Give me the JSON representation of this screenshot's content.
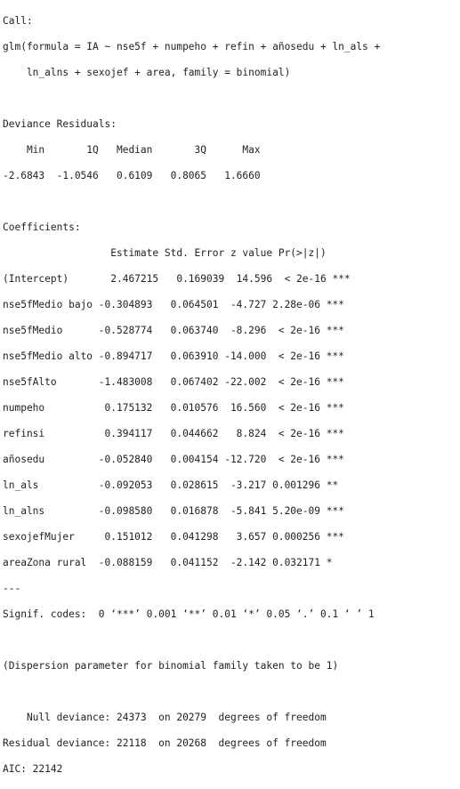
{
  "console": {
    "call_header": "Call:",
    "call_line1": "glm(formula = IA ~ nse5f + numpeho + refin + añosedu + ln_als +",
    "call_line2": "    ln_alns + sexojef + area, family = binomial)",
    "resid_header": "Deviance Residuals:",
    "resid_labels": "    Min       1Q   Median       3Q      Max",
    "resid_values": "-2.6843  -1.0546   0.6109   0.8065   1.6660",
    "coef_header": "Coefficients:",
    "coef_columns": "                  Estimate Std. Error z value Pr(>|z|)",
    "coef_rows": [
      "(Intercept)       2.467215   0.169039  14.596  < 2e-16 ***",
      "nse5fMedio bajo -0.304893   0.064501  -4.727 2.28e-06 ***",
      "nse5fMedio      -0.528774   0.063740  -8.296  < 2e-16 ***",
      "nse5fMedio alto -0.894717   0.063910 -14.000  < 2e-16 ***",
      "nse5fAlto       -1.483008   0.067402 -22.002  < 2e-16 ***",
      "numpeho          0.175132   0.010576  16.560  < 2e-16 ***",
      "refinsi          0.394117   0.044662   8.824  < 2e-16 ***",
      "añosedu         -0.052840   0.004154 -12.720  < 2e-16 ***",
      "ln_als          -0.092053   0.028615  -3.217 0.001296 **",
      "ln_alns         -0.098580   0.016878  -5.841 5.20e-09 ***",
      "sexojefMujer     0.151012   0.041298   3.657 0.000256 ***",
      "areaZona rural  -0.088159   0.041152  -2.142 0.032171 *"
    ],
    "signif_sep": "---",
    "signif_codes": "Signif. codes:  0 ‘***’ 0.001 ‘**’ 0.01 ‘*’ 0.05 ‘.’ 0.1 ‘ ’ 1",
    "dispersion": "(Dispersion parameter for binomial family taken to be 1)",
    "null_deviance": "    Null deviance: 24373  on 20279  degrees of freedom",
    "residual_deviance": "Residual deviance: 22118  on 20268  degrees of freedom",
    "aic": "AIC: 22142"
  },
  "colors": {
    "text": "#222222",
    "background": "#ffffff"
  }
}
